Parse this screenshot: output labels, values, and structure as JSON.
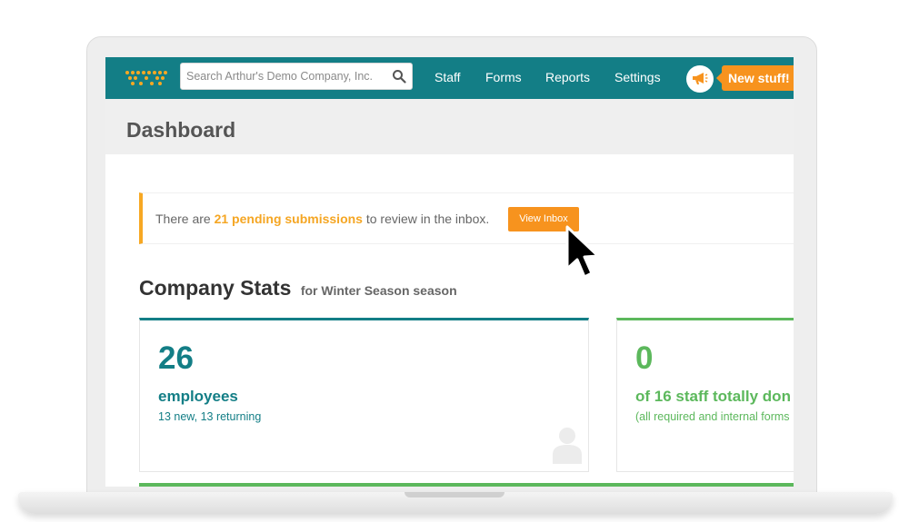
{
  "header": {
    "search": {
      "placeholder": "Search Arthur's Demo Company, Inc.",
      "icon": "search-icon"
    },
    "nav": [
      {
        "label": "Staff"
      },
      {
        "label": "Forms"
      },
      {
        "label": "Reports"
      },
      {
        "label": "Settings"
      }
    ],
    "announcement": {
      "icon": "megaphone-icon",
      "label": "New stuff!"
    }
  },
  "page": {
    "title": "Dashboard"
  },
  "alert": {
    "prefix": "There are",
    "highlight": "21 pending submissions",
    "suffix": "to review in the inbox.",
    "button_label": "View Inbox"
  },
  "stats": {
    "title": "Company Stats",
    "subtitle": "for Winter Season season",
    "cards": [
      {
        "number": "26",
        "label": "employees",
        "detail": "13 new, 13 returning",
        "icon": "person-icon"
      },
      {
        "number": "0",
        "label": "of 16 staff totally don",
        "detail": "(all required and internal forms"
      }
    ]
  },
  "colors": {
    "header_bg": "#137e86",
    "accent_orange": "#f7931e",
    "highlight_orange": "#f5a623",
    "teal_text": "#137e86",
    "green_text": "#5cb85c"
  }
}
